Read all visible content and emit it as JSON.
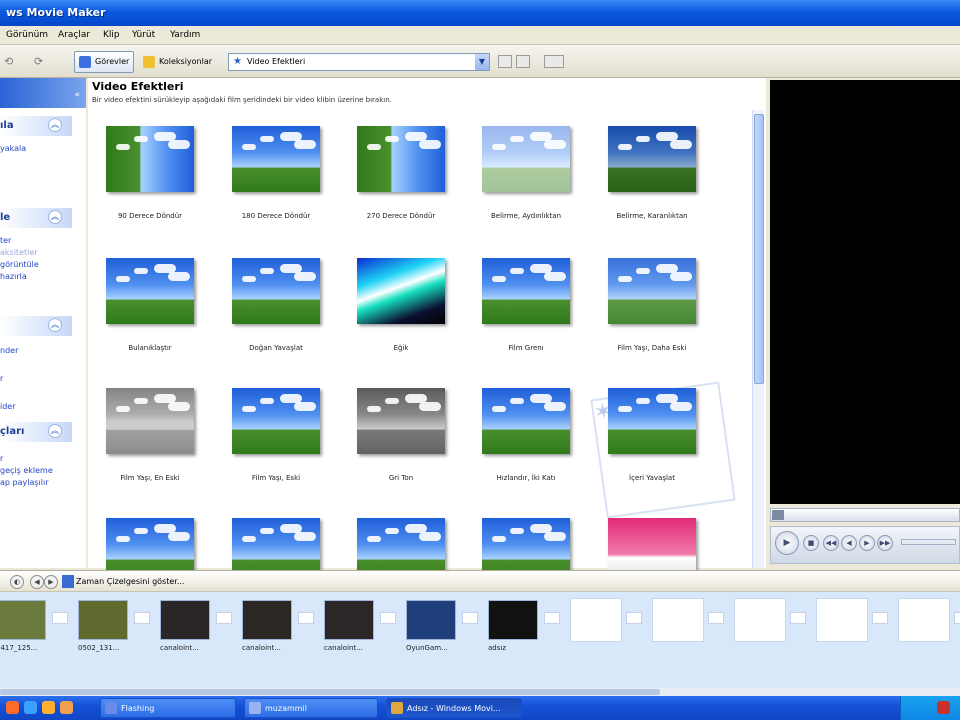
{
  "window": {
    "title": "ws Movie Maker"
  },
  "menu": [
    "Görünüm",
    "Araçlar",
    "Klip",
    "Yürüt",
    "Yardım"
  ],
  "toolbar": {
    "back": "⟲",
    "forward": "⟳",
    "tasks_label": "Görevler",
    "collections_label": "Koleksiyonlar",
    "collection_select": "Video Efektleri"
  },
  "taskpane": {
    "sections": [
      "ıla",
      "le",
      "",
      "çları"
    ],
    "links": [
      "yakala",
      "ter",
      "aksitetler",
      "görüntüle",
      "hazırla",
      "nder",
      "r",
      "ider",
      "",
      "r",
      "geçiş ekleme",
      "ap paylaşılır"
    ]
  },
  "content": {
    "title": "Video Efektleri",
    "description": "Bir video efektini sürükleyip aşağıdaki film şeridindeki bir video klibin üzerine bırakın.",
    "effects": [
      {
        "label": "90 Derece Döndür",
        "style": "rot"
      },
      {
        "label": "180 Derece Döndür",
        "style": "normal"
      },
      {
        "label": "270 Derece Döndür",
        "style": "rot"
      },
      {
        "label": "Belirme, Aydınlıktan",
        "style": "fade"
      },
      {
        "label": "Belirme, Karanlıktan",
        "style": "dark"
      },
      {
        "label": "Bulanıklaştır",
        "style": "normal"
      },
      {
        "label": "Doğan Yavaşlat",
        "style": "normal"
      },
      {
        "label": "Eğik",
        "style": "eerie"
      },
      {
        "label": "Film Grenı",
        "style": "normal"
      },
      {
        "label": "Film Yaşı, Daha Eski",
        "style": "old"
      },
      {
        "label": "Film Yaşı, En Eski",
        "style": "oldest"
      },
      {
        "label": "Film Yaşı, Eski",
        "style": "normal"
      },
      {
        "label": "Gri Ton",
        "style": "grey"
      },
      {
        "label": "Hızlandır, İki Katı",
        "style": "normal"
      },
      {
        "label": "İçeri Yavaşlat",
        "style": "normal"
      },
      {
        "label": "",
        "style": "normal"
      },
      {
        "label": "",
        "style": "normal"
      },
      {
        "label": "",
        "style": "normal"
      },
      {
        "label": "",
        "style": "normal"
      },
      {
        "label": "",
        "style": "pink"
      }
    ]
  },
  "preview": {
    "controls": [
      "▶",
      "■",
      "◀◀",
      "◀",
      "▶",
      "▶▶"
    ]
  },
  "storyboard": {
    "timeline_label": "Zaman Çizelgesini göster...",
    "clips": [
      {
        "label": "0417_125...",
        "color": "#6a7a3c"
      },
      {
        "label": "0502_131...",
        "color": "#5e6a2e"
      },
      {
        "label": "canaloint...",
        "color": "#2a2626"
      },
      {
        "label": "canaloint...",
        "color": "#2b2823"
      },
      {
        "label": "canaloint...",
        "color": "#2c2726"
      },
      {
        "label": "OyunGam...",
        "color": "#1f3f7a"
      },
      {
        "label": "adsız",
        "color": "#111111"
      }
    ]
  },
  "taskbar": {
    "items": [
      {
        "label": "Flashing",
        "color": "#6a8ae8"
      },
      {
        "label": "muzammil",
        "color": "#9ab3f0"
      },
      {
        "label": "Adsız - Windows Movi...",
        "color": "#e0a640"
      }
    ]
  }
}
